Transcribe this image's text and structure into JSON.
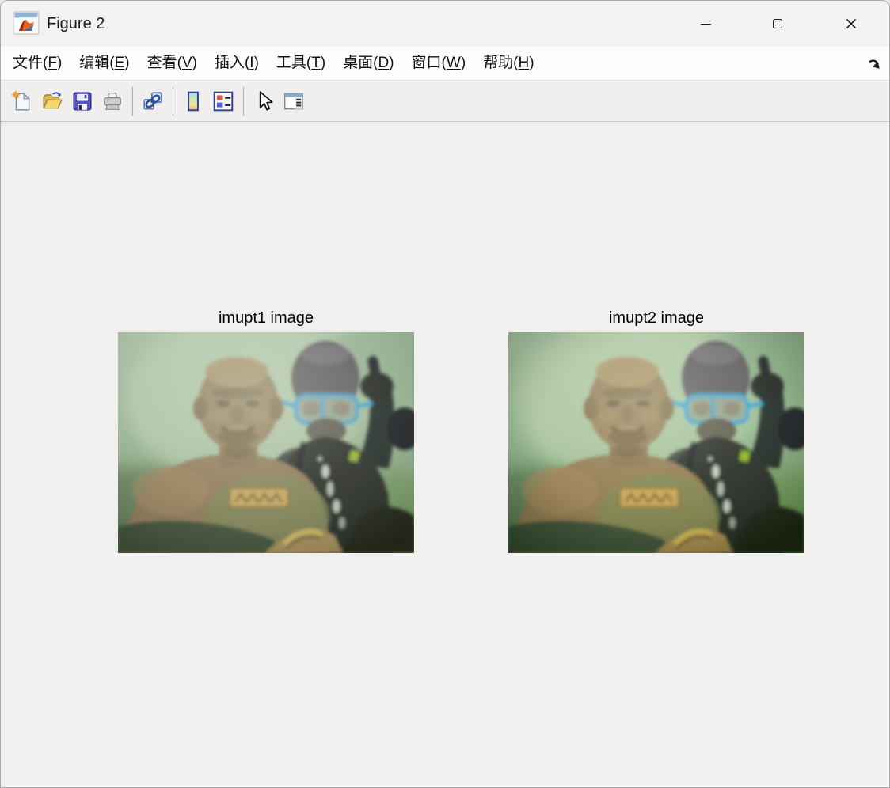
{
  "window": {
    "title": "Figure 2",
    "app_icon": "matlab-figure-icon",
    "controls": [
      "minimize",
      "maximize",
      "close"
    ]
  },
  "menu": {
    "items": [
      {
        "prefix": "文件(",
        "mnemonic": "F",
        "suffix": ")"
      },
      {
        "prefix": "编辑(",
        "mnemonic": "E",
        "suffix": ")"
      },
      {
        "prefix": "查看(",
        "mnemonic": "V",
        "suffix": ")"
      },
      {
        "prefix": "插入(",
        "mnemonic": "I",
        "suffix": ")"
      },
      {
        "prefix": "工具(",
        "mnemonic": "T",
        "suffix": ")"
      },
      {
        "prefix": "桌面(",
        "mnemonic": "D",
        "suffix": ")"
      },
      {
        "prefix": "窗口(",
        "mnemonic": "W",
        "suffix": ")"
      },
      {
        "prefix": "帮助(",
        "mnemonic": "H",
        "suffix": ")"
      }
    ],
    "dock_icon": "dock-figure-arrow-icon"
  },
  "toolbar": {
    "icons": [
      "new-figure-icon",
      "open-file-icon",
      "save-figure-icon",
      "print-figure-icon",
      "link-plot-icon",
      "insert-colorbar-icon",
      "insert-legend-icon",
      "edit-plot-icon",
      "property-inspector-icon"
    ]
  },
  "figure": {
    "axes": [
      {
        "title": "imupt1 image",
        "content": "underwater-photo-statue-and-diver"
      },
      {
        "title": "imupt2 image",
        "content": "underwater-photo-statue-and-diver-enhanced"
      }
    ]
  },
  "colors": {
    "titlebar_bg": "#f3f2f1",
    "menubar_bg": "#fdfdfd",
    "toolbar_bg": "#f0efee",
    "canvas_bg": "#f1f0ef",
    "water_green": "#96b292",
    "statue_brown": "#8b7150",
    "dive_mask_blue": "#3a9ed2",
    "wetsuit_black": "#1b1c1f"
  }
}
